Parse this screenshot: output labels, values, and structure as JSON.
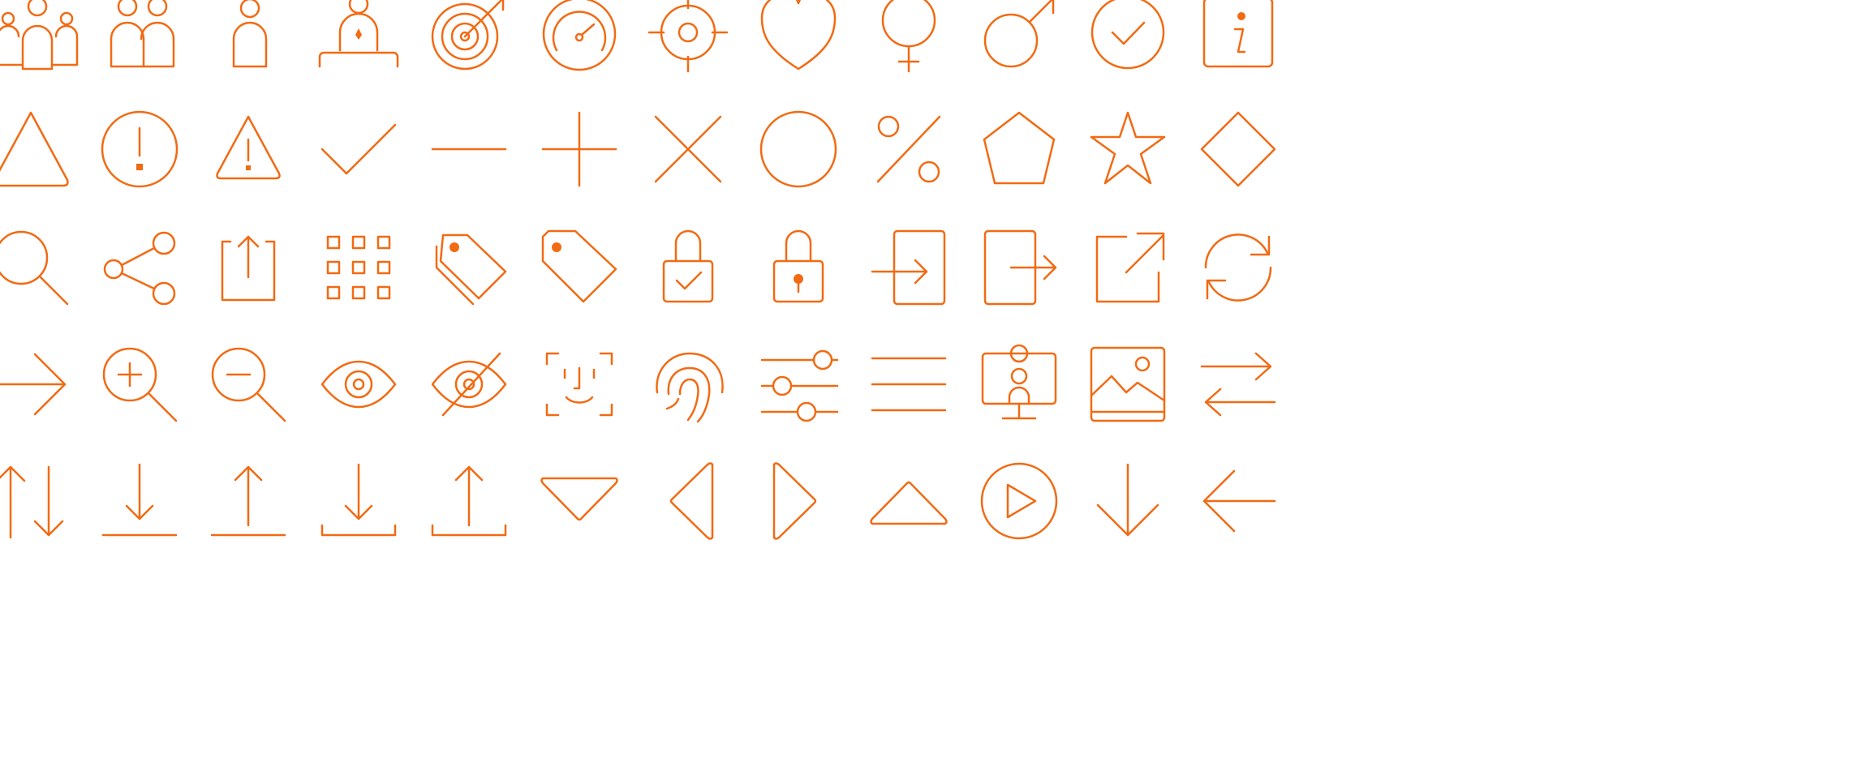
{
  "colors": {
    "accent": "#F26A12",
    "background": "#FFFFFF"
  },
  "icon_rows": [
    [
      "users-group-icon",
      "users-pair-icon",
      "user-icon",
      "presenter-icon",
      "target-icon",
      "speedometer-icon",
      "crosshair-icon",
      "heart-icon",
      "female-icon",
      "male-icon",
      "check-circle-icon",
      "info-square-icon"
    ],
    [
      "triangle-icon",
      "alert-circle-icon",
      "warning-triangle-icon",
      "check-icon",
      "minus-icon",
      "plus-icon",
      "close-icon",
      "circle-icon",
      "percent-icon",
      "pentagon-icon",
      "star-icon",
      "diamond-icon"
    ],
    [
      "search-icon",
      "share-icon",
      "upload-box-icon",
      "grid-icon",
      "tags-icon",
      "tag-icon",
      "lock-check-icon",
      "lock-icon",
      "login-icon",
      "logout-icon",
      "external-link-icon",
      "refresh-icon"
    ],
    [
      "arrow-right-icon",
      "zoom-in-icon",
      "zoom-out-icon",
      "eye-icon",
      "eye-off-icon",
      "face-id-icon",
      "fingerprint-icon",
      "sliders-icon",
      "menu-icon",
      "screen-user-icon",
      "image-icon",
      "swap-horizontal-icon"
    ],
    [
      "swap-vertical-icon",
      "download-line-icon",
      "upload-line-icon",
      "download-tray-icon",
      "upload-tray-icon",
      "caret-down-icon",
      "caret-left-icon",
      "caret-right-icon",
      "caret-up-icon",
      "play-circle-icon",
      "arrow-down-icon",
      "arrow-left-icon"
    ]
  ]
}
